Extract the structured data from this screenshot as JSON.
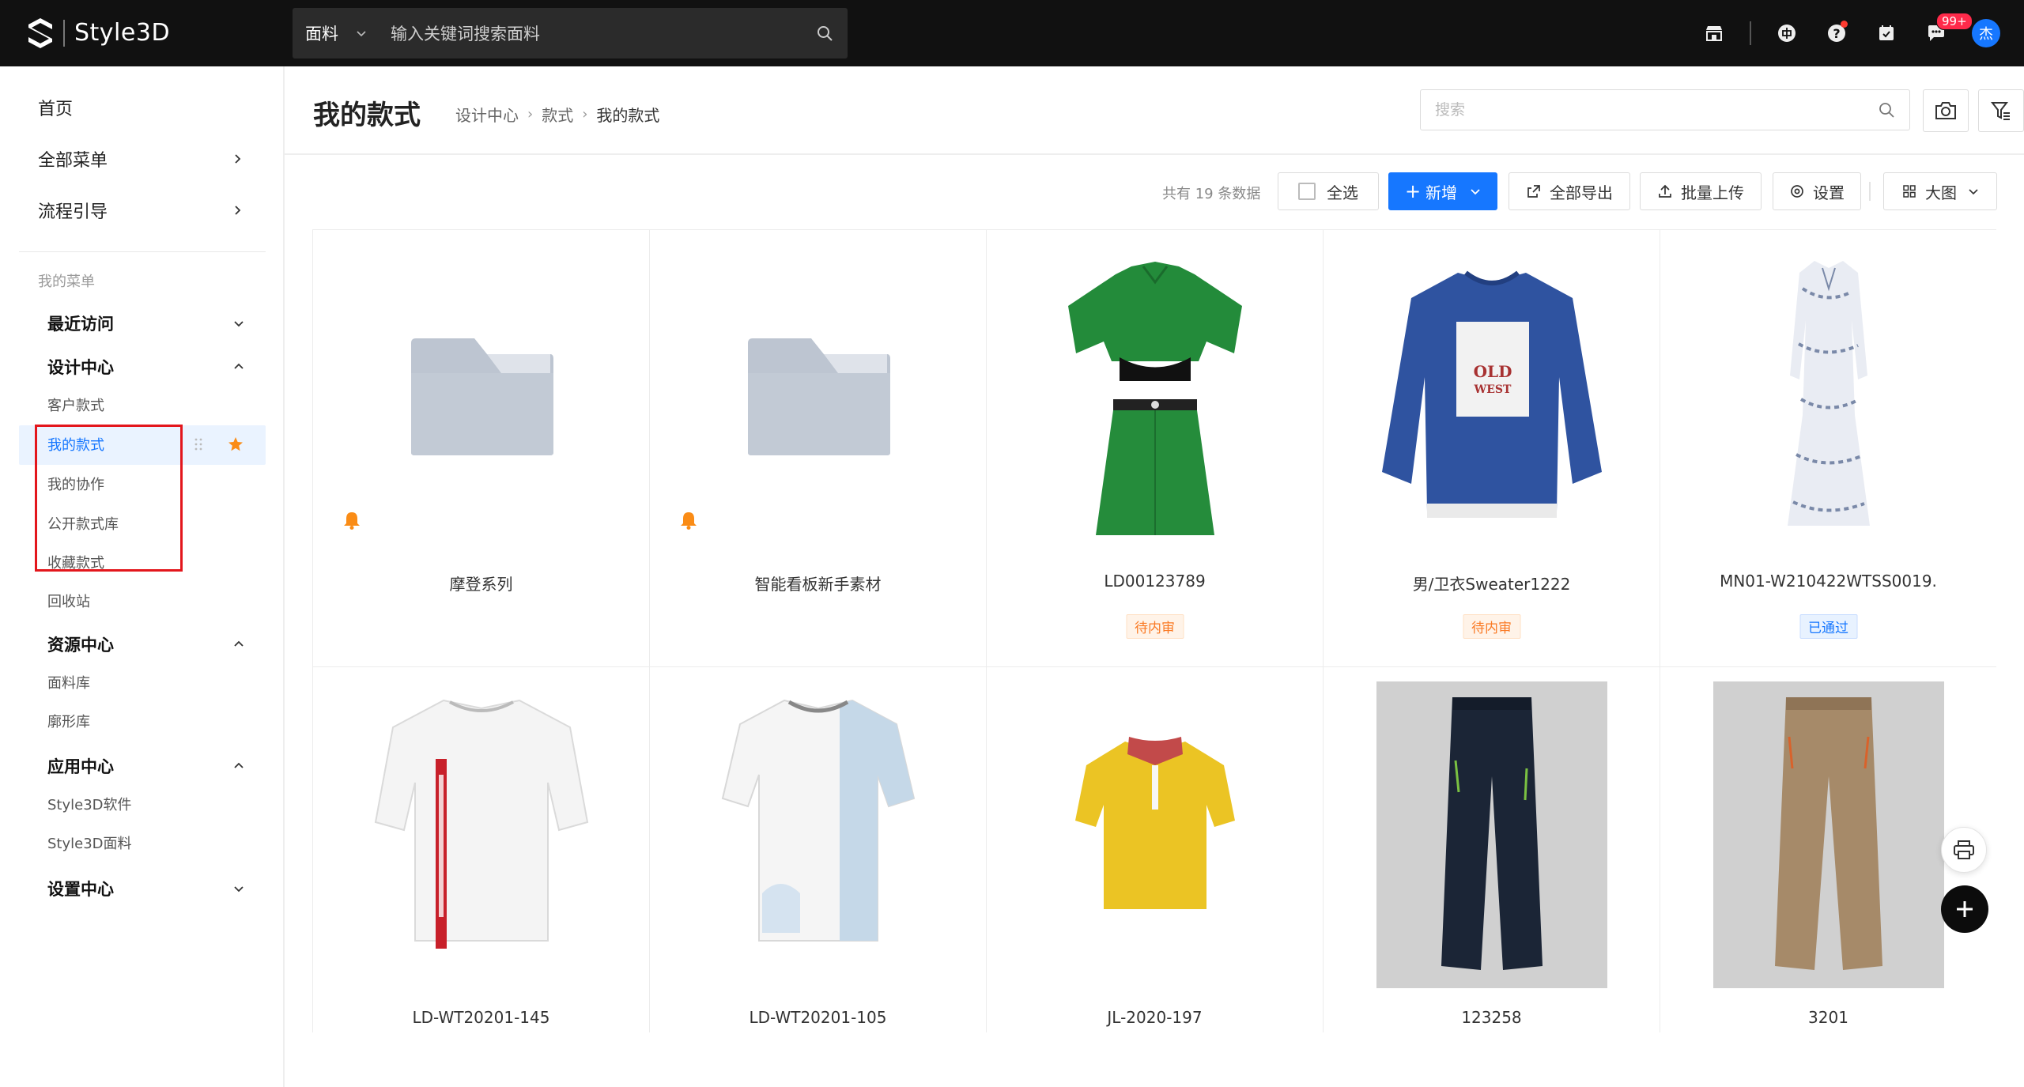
{
  "app": {
    "logo_text": "Style3D"
  },
  "topbar": {
    "search_type": "面料",
    "search_placeholder": "输入关键词搜索面料",
    "icons": [
      "store-icon",
      "cn-language-icon",
      "help-icon",
      "task-icon",
      "message-icon"
    ],
    "message_badge": "99+",
    "avatar_text": "杰"
  },
  "sidebar": {
    "top_items": [
      {
        "label": "首页"
      },
      {
        "label": "全部菜单"
      },
      {
        "label": "流程引导"
      }
    ],
    "my_menu_caption": "我的菜单",
    "groups": {
      "recent": "最近访问",
      "design": "设计中心",
      "design_items": [
        "客户款式",
        "我的款式",
        "我的协作",
        "公开款式库",
        "收藏款式",
        "回收站"
      ],
      "resource": "资源中心",
      "resource_items": [
        "面料库",
        "廓形库"
      ],
      "apps": "应用中心",
      "apps_items": [
        "Style3D软件",
        "Style3D面料"
      ],
      "settings": "设置中心"
    }
  },
  "header": {
    "title": "我的款式",
    "breadcrumb": [
      "设计中心",
      "款式",
      "我的款式"
    ],
    "search_placeholder": "搜索"
  },
  "toolbar": {
    "total_text": "共有 19 条数据",
    "select_all": "全选",
    "add": "新增",
    "export_all": "全部导出",
    "batch_upload": "批量上传",
    "settings": "设置",
    "view_mode": "大图"
  },
  "items": [
    {
      "name": "摩登系列",
      "kind": "folder"
    },
    {
      "name": "智能看板新手素材",
      "kind": "folder"
    },
    {
      "name": "LD00123789",
      "status": "待内审",
      "status_type": "pending",
      "garment": "green-set"
    },
    {
      "name": "男/卫衣Sweater1222",
      "status": "待内审",
      "status_type": "pending",
      "garment": "blue-sweater"
    },
    {
      "name": "MN01-W210422WTSS0019.",
      "status": "已通过",
      "status_type": "passed",
      "garment": "floral-dress"
    },
    {
      "name": "LD-WT20201-145",
      "garment": "white-tee-red"
    },
    {
      "name": "LD-WT20201-105",
      "garment": "white-blue-tee"
    },
    {
      "name": "JL-2020-197",
      "garment": "yellow-polo"
    },
    {
      "name": "123258",
      "garment": "navy-pants"
    },
    {
      "name": "3201",
      "garment": "khaki-pants"
    }
  ],
  "colors": {
    "accent": "#1677ff",
    "topbar": "#111111",
    "pending": "#fa7a24",
    "highlight_box": "#e3161c",
    "star": "#fa8c16"
  }
}
